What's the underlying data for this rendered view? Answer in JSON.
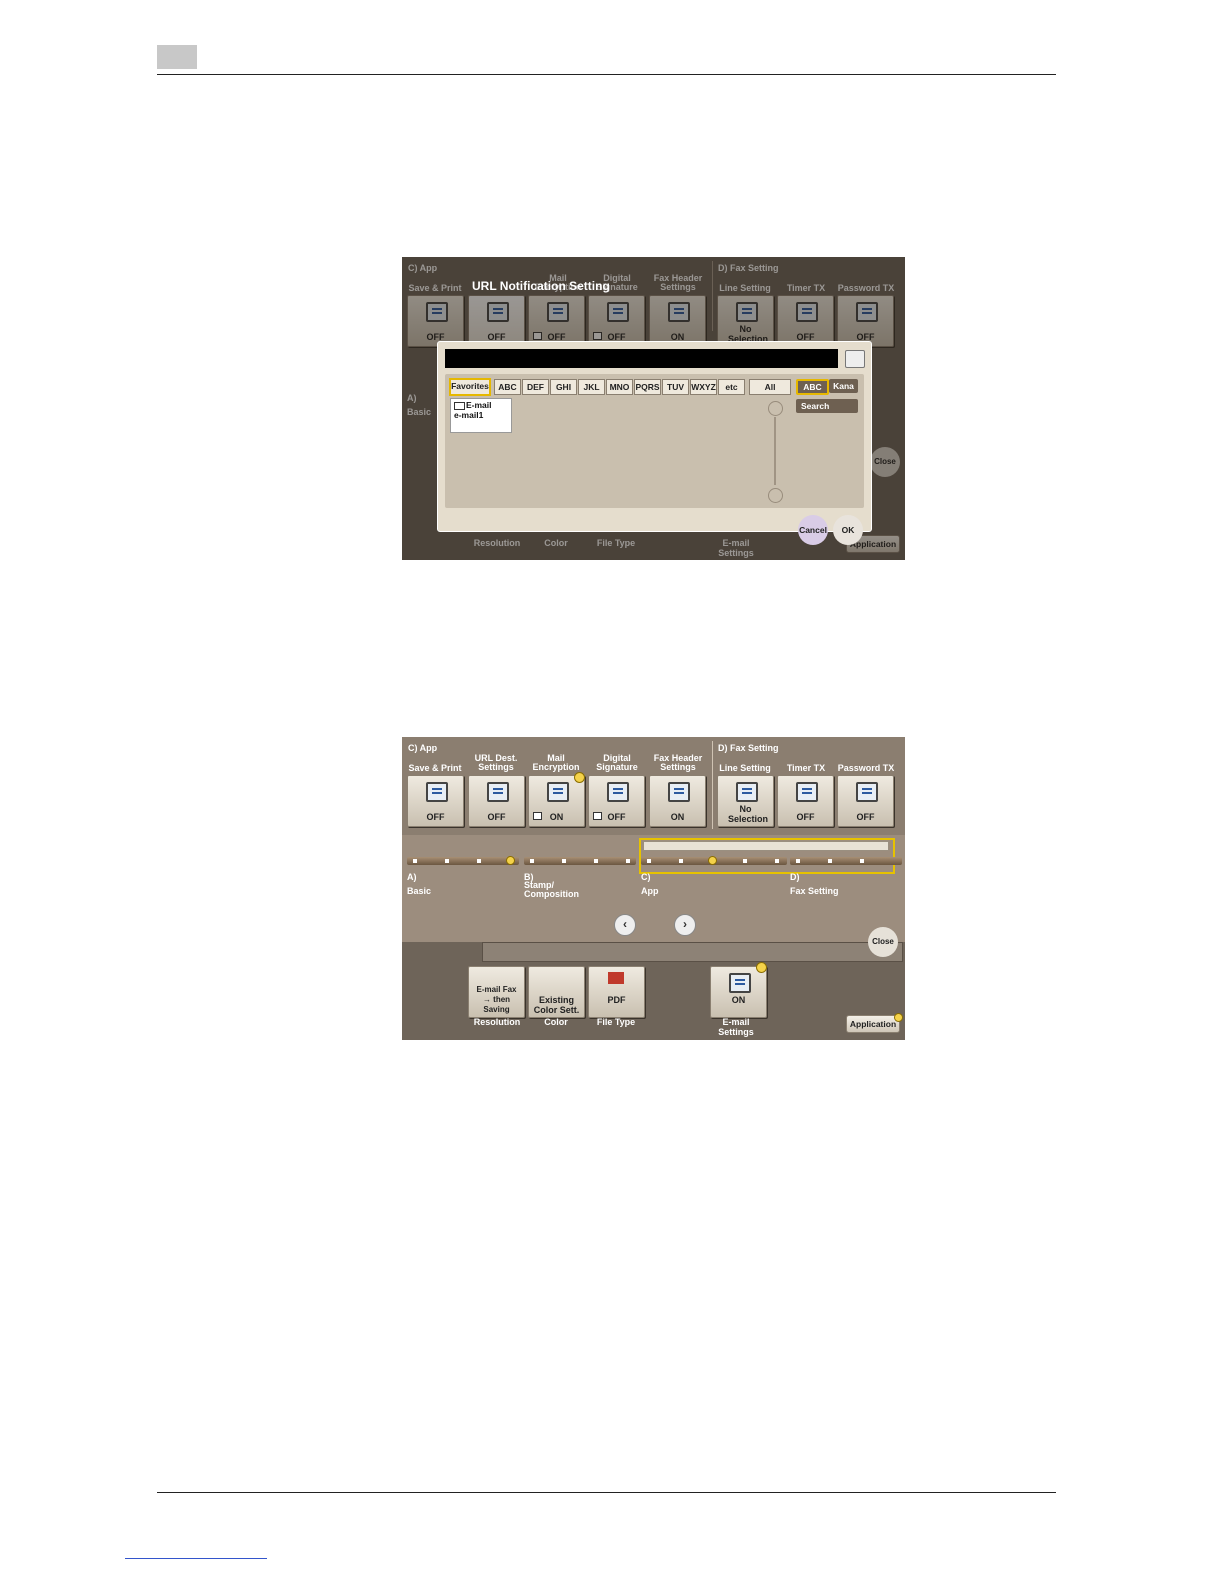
{
  "screen1": {
    "sections": {
      "app": "C)   App",
      "fax": "D)   Fax Setting"
    },
    "tile_labels": [
      "Save & Print",
      "Mail Encryption",
      "Digital Signature",
      "Fax Header Settings",
      "Line Setting",
      "Timer TX",
      "Password TX"
    ],
    "tile_values": [
      "OFF",
      "OFF",
      "OFF",
      "OFF",
      "ON",
      "No Selection",
      "OFF",
      "OFF"
    ],
    "dialog": {
      "title": "URL Notification Setting",
      "tabs": [
        "Favorites",
        "ABC",
        "DEF",
        "GHI",
        "JKL",
        "MNO",
        "PQRS",
        "TUV",
        "WXYZ",
        "etc"
      ],
      "all": "All",
      "mode_abc": "ABC",
      "mode_kana": "Kana",
      "search": "Search",
      "list_item_type": "E-mail",
      "list_item_name": "e-mail1",
      "cancel": "Cancel",
      "ok": "OK"
    },
    "side": {
      "a": "A)",
      "basic": "Basic",
      "close": "Close",
      "application": "Application"
    },
    "bottom_labels": [
      "Resolution",
      "Color",
      "File Type",
      "E-mail Settings"
    ]
  },
  "screen2": {
    "sections": {
      "app": "C)   App",
      "fax": "D)   Fax Setting"
    },
    "tile_labels": [
      "Save & Print",
      "URL Dest. Settings",
      "Mail Encryption",
      "Digital Signature",
      "Fax Header Settings",
      "Line Setting",
      "Timer TX",
      "Password TX"
    ],
    "tile_values": [
      "OFF",
      "OFF",
      "ON",
      "OFF",
      "ON",
      "No Selection",
      "OFF",
      "OFF"
    ],
    "groups": [
      "A)",
      "Basic",
      "B)",
      "Stamp/ Composition",
      "C)",
      "App",
      "D)",
      "Fax Setting"
    ],
    "close": "Close",
    "bottom_values": [
      "E-mail Fax → then Saving",
      "Existing Color Sett.",
      "PDF",
      "ON"
    ],
    "bottom_labels": [
      "Resolution",
      "Color",
      "File Type",
      "E-mail Settings"
    ],
    "application": "Application"
  }
}
